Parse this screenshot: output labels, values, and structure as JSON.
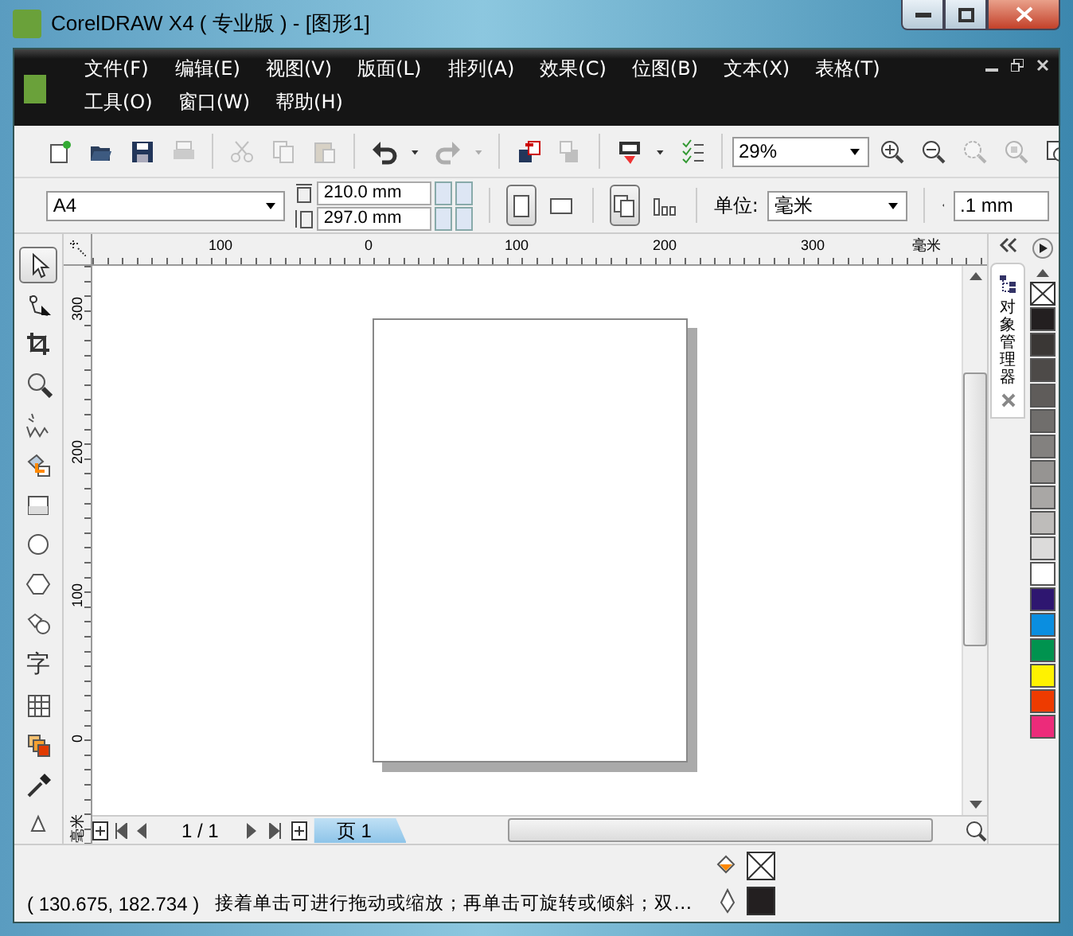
{
  "window": {
    "title": "CorelDRAW X4 ( 专业版 ) - [图形1]"
  },
  "menu_rows": [
    [
      "文件(F)",
      "编辑(E)",
      "视图(V)",
      "版面(L)",
      "排列(A)",
      "效果(C)",
      "位图(B)",
      "文本(X)",
      "表格(T)"
    ],
    [
      "工具(O)",
      "窗口(W)",
      "帮助(H)"
    ]
  ],
  "toolbar": [
    {
      "kind": "new",
      "disabled": false
    },
    {
      "kind": "open",
      "disabled": false
    },
    {
      "kind": "save",
      "disabled": false
    },
    {
      "kind": "print",
      "disabled": true
    },
    {
      "kind": "separator"
    },
    {
      "kind": "cut",
      "disabled": true
    },
    {
      "kind": "copy",
      "disabled": true
    },
    {
      "kind": "paste",
      "disabled": true
    },
    {
      "kind": "separator"
    },
    {
      "kind": "undo",
      "disabled": false
    },
    {
      "kind": "caret",
      "disabled": false
    },
    {
      "kind": "redo",
      "disabled": true
    },
    {
      "kind": "caret",
      "disabled": true
    },
    {
      "kind": "separator"
    },
    {
      "kind": "import",
      "disabled": false
    },
    {
      "kind": "export",
      "disabled": true
    },
    {
      "kind": "separator"
    },
    {
      "kind": "publish",
      "disabled": false
    },
    {
      "kind": "caret",
      "disabled": false
    },
    {
      "kind": "options",
      "disabled": false
    },
    {
      "kind": "separator"
    },
    {
      "kind": "zoom",
      "value": "29%"
    },
    {
      "kind": "zoom-in",
      "disabled": false
    },
    {
      "kind": "zoom-out",
      "disabled": false
    },
    {
      "kind": "zoom-selected",
      "disabled": true
    },
    {
      "kind": "zoom-all",
      "disabled": true
    },
    {
      "kind": "zoom-page",
      "disabled": false
    }
  ],
  "property_bar": {
    "paper": "A4",
    "width": "210.0 mm",
    "height": "297.0 mm",
    "orientation": [
      {
        "kind": "portrait",
        "selected": true
      },
      {
        "kind": "landscape",
        "selected": false
      }
    ],
    "page_layout": [
      {
        "kind": "all-pages",
        "selected": true
      },
      {
        "kind": "current-page",
        "selected": false
      }
    ],
    "units_label": "单位:",
    "units": "毫米",
    "nudge": ".1 mm"
  },
  "horizontal_ruler": [
    "100",
    "0",
    "100",
    "200",
    "300",
    "毫米"
  ],
  "vertical_ruler": [
    "300",
    "200",
    "100",
    "0",
    "毫米"
  ],
  "toolbox": [
    {
      "kind": "pick",
      "selected": true
    },
    {
      "kind": "shape",
      "selected": false
    },
    {
      "kind": "crop",
      "selected": false
    },
    {
      "kind": "zoom",
      "selected": false
    },
    {
      "kind": "freehand",
      "selected": false
    },
    {
      "kind": "smart-fill",
      "selected": false
    },
    {
      "kind": "rectangle",
      "selected": false
    },
    {
      "kind": "ellipse",
      "selected": false
    },
    {
      "kind": "polygon",
      "selected": false
    },
    {
      "kind": "basic-shapes",
      "selected": false
    },
    {
      "kind": "text",
      "glyph": "字",
      "selected": false
    },
    {
      "kind": "table",
      "selected": false
    },
    {
      "kind": "blend",
      "selected": false
    },
    {
      "kind": "eyedropper",
      "selected": false
    },
    {
      "kind": "outline",
      "selected": false
    }
  ],
  "docker_tab": {
    "label": "对象管理器"
  },
  "palette": [
    {
      "kind": "none"
    },
    {
      "kind": "swatch",
      "color": "#231f20"
    },
    {
      "kind": "swatch",
      "color": "#3a3735"
    },
    {
      "kind": "swatch",
      "color": "#4d4a48"
    },
    {
      "kind": "swatch",
      "color": "#5f5c5a"
    },
    {
      "kind": "swatch",
      "color": "#706e6c"
    },
    {
      "kind": "swatch",
      "color": "#83817f"
    },
    {
      "kind": "swatch",
      "color": "#969492"
    },
    {
      "kind": "swatch",
      "color": "#a9a7a5"
    },
    {
      "kind": "swatch",
      "color": "#bebcba"
    },
    {
      "kind": "swatch",
      "color": "#dcdbda"
    },
    {
      "kind": "swatch",
      "color": "#ffffff"
    },
    {
      "kind": "swatch",
      "color": "#2e1670"
    },
    {
      "kind": "swatch",
      "color": "#0a8ee0"
    },
    {
      "kind": "swatch",
      "color": "#00934f"
    },
    {
      "kind": "swatch",
      "color": "#fff200"
    },
    {
      "kind": "swatch",
      "color": "#ee3b00"
    },
    {
      "kind": "swatch",
      "color": "#ec2b7a"
    }
  ],
  "page_navigator": {
    "counter": "1 / 1",
    "tabs": [
      {
        "label": "页 1",
        "selected": true
      }
    ]
  },
  "status_bar": {
    "coordinates": "( 130.675, 182.734 )",
    "message": "接着单击可进行拖动或缩放；再单击可旋转或倾斜；双…",
    "fill": {
      "none": true
    },
    "outline": {
      "none": false,
      "color": "#231f20"
    }
  }
}
